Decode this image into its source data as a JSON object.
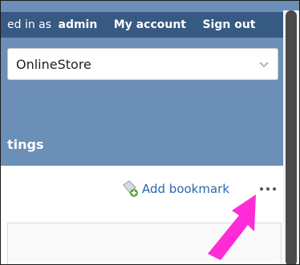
{
  "topbar": {
    "logged_in_prefix": "ed in as",
    "username": "admin",
    "my_account": "My account",
    "sign_out": "Sign out"
  },
  "store_selector": {
    "value": "OnlineStore",
    "icon": "chevron-down-icon"
  },
  "section": {
    "title": "tings"
  },
  "bookmark": {
    "label": "Add bookmark",
    "icon": "bookmark-add-icon"
  },
  "more_menu": {
    "icon": "more-dots-icon"
  },
  "colors": {
    "header_bg": "#6b8fb6",
    "topbar_bg": "#375a82",
    "link": "#2a66a8",
    "arrow": "#ff2bd6"
  }
}
